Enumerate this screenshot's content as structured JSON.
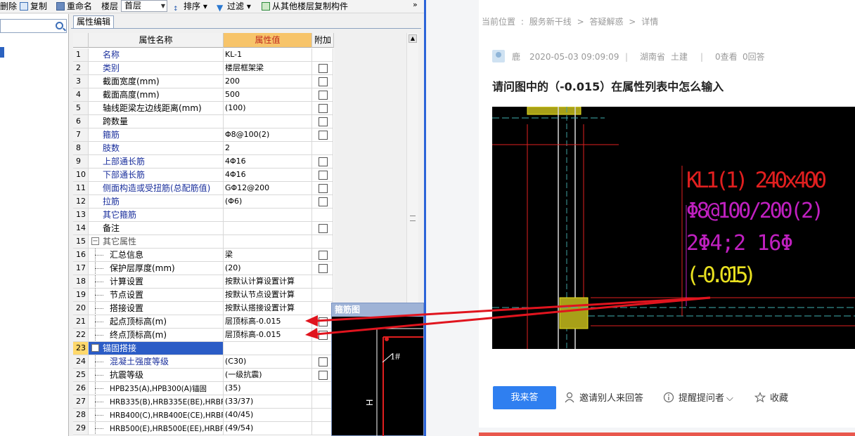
{
  "toolbar": {
    "delete_label": "删除",
    "copy_label": "复制",
    "rename_label": "重命名",
    "floor_label": "楼层",
    "floor_value": "首层",
    "sort_label": "排序",
    "filter_label": "过滤",
    "copy_from_floor_label": "从其他楼层复制构件",
    "more_label": "»"
  },
  "tab": {
    "label": "属性编辑"
  },
  "grid": {
    "headers": {
      "name": "属性名称",
      "value": "属性值",
      "extra": "附加"
    },
    "rows": [
      {
        "n": "1",
        "name": "名称",
        "value": "KL-1",
        "check": false,
        "style": "blue",
        "indent": 0
      },
      {
        "n": "2",
        "name": "类别",
        "value": "楼层框架梁",
        "check": true,
        "style": "blue",
        "indent": 0
      },
      {
        "n": "3",
        "name": "截面宽度(mm)",
        "value": "200",
        "check": true,
        "style": "",
        "indent": 0
      },
      {
        "n": "4",
        "name": "截面高度(mm)",
        "value": "500",
        "check": true,
        "style": "",
        "indent": 0
      },
      {
        "n": "5",
        "name": "轴线距梁左边线距离(mm)",
        "value": "(100)",
        "check": true,
        "style": "",
        "indent": 0
      },
      {
        "n": "6",
        "name": "跨数量",
        "value": "",
        "check": true,
        "style": "",
        "indent": 0
      },
      {
        "n": "7",
        "name": "箍筋",
        "value": "Φ8@100(2)",
        "check": true,
        "style": "blue",
        "indent": 0
      },
      {
        "n": "8",
        "name": "肢数",
        "value": "2",
        "check": false,
        "style": "blue",
        "indent": 0
      },
      {
        "n": "9",
        "name": "上部通长筋",
        "value": "4Φ16",
        "check": true,
        "style": "blue",
        "indent": 0
      },
      {
        "n": "10",
        "name": "下部通长筋",
        "value": "4Φ16",
        "check": true,
        "style": "blue",
        "indent": 0
      },
      {
        "n": "11",
        "name": "侧面构造或受扭筋(总配筋值)",
        "value": "GΦ12@200",
        "check": true,
        "style": "blue",
        "indent": 0
      },
      {
        "n": "12",
        "name": "拉筋",
        "value": "(Φ6)",
        "check": true,
        "style": "blue",
        "indent": 0
      },
      {
        "n": "13",
        "name": "其它箍筋",
        "value": "",
        "check": false,
        "style": "blue",
        "indent": 0
      },
      {
        "n": "14",
        "name": "备注",
        "value": "",
        "check": true,
        "style": "",
        "indent": 0
      },
      {
        "n": "15",
        "name": "其它属性",
        "value": "",
        "check": false,
        "style": "gray",
        "indent": 0,
        "group": true
      },
      {
        "n": "16",
        "name": "汇总信息",
        "value": "梁",
        "check": true,
        "style": "",
        "indent": 1
      },
      {
        "n": "17",
        "name": "保护层厚度(mm)",
        "value": "(20)",
        "check": true,
        "style": "",
        "indent": 1
      },
      {
        "n": "18",
        "name": "计算设置",
        "value": "按默认计算设置计算",
        "check": false,
        "style": "",
        "indent": 1
      },
      {
        "n": "19",
        "name": "节点设置",
        "value": "按默认节点设置计算",
        "check": false,
        "style": "",
        "indent": 1
      },
      {
        "n": "20",
        "name": "搭接设置",
        "value": "按默认搭接设置计算",
        "check": false,
        "style": "",
        "indent": 1
      },
      {
        "n": "21",
        "name": "起点顶标高(m)",
        "value": "层顶标高-0.015",
        "check": true,
        "style": "",
        "indent": 1
      },
      {
        "n": "22",
        "name": "终点顶标高(m)",
        "value": "层顶标高-0.015",
        "check": true,
        "style": "",
        "indent": 1
      },
      {
        "n": "23",
        "name": "锚固搭接",
        "value": "",
        "check": false,
        "style": "",
        "indent": 0,
        "group": true,
        "selected": true
      },
      {
        "n": "24",
        "name": "混凝土强度等级",
        "value": "(C30)",
        "check": true,
        "style": "blue",
        "indent": 1
      },
      {
        "n": "25",
        "name": "抗震等级",
        "value": "(一级抗震)",
        "check": true,
        "style": "",
        "indent": 1
      },
      {
        "n": "26",
        "name": "HPB235(A),HPB300(A)锚固",
        "value": "(35)",
        "check": false,
        "style": "",
        "indent": 1
      },
      {
        "n": "27",
        "name": "HRB335(B),HRB335E(BE),HRBF",
        "value": "(33/37)",
        "check": false,
        "style": "",
        "indent": 1
      },
      {
        "n": "28",
        "name": "HRB400(C),HRB400E(CE),HRBF",
        "value": "(40/45)",
        "check": false,
        "style": "",
        "indent": 1
      },
      {
        "n": "29",
        "name": "HRB500(E),HRB500E(EE),HRBF",
        "value": "(49/54)",
        "check": false,
        "style": "",
        "indent": 1
      }
    ]
  },
  "stirrup_window": {
    "title": "箍筋图",
    "mark": "1#",
    "dim": "H"
  },
  "web": {
    "breadcrumb": [
      "当前位置",
      ":",
      "服务新干线",
      ">",
      "答疑解惑",
      ">",
      "详情"
    ],
    "meta": {
      "user": "鹿",
      "datetime": "2020-05-03 09:09:09",
      "region": "湖南省",
      "category": "土建",
      "views": "0查看",
      "answers": "0回答"
    },
    "question_title": "请问图中的（-0.015）在属性列表中怎么输入",
    "cad_text": {
      "line1": "KL1(1) 240x400",
      "line2": "Φ8@100/200(2)",
      "line3": "2Φ4;2 16Φ",
      "line4": "(-0.015)"
    },
    "answer_button": "我来答",
    "invite_label": "邀请别人来回答",
    "remind_label": "提醒提问者",
    "favorite_label": "收藏"
  },
  "colors": {
    "accent_blue": "#2f7ff0",
    "cad_red": "#e01f1f",
    "cad_magenta": "#c020c0",
    "cad_yellow": "#e8e020",
    "arrow_red": "#e0141e"
  }
}
